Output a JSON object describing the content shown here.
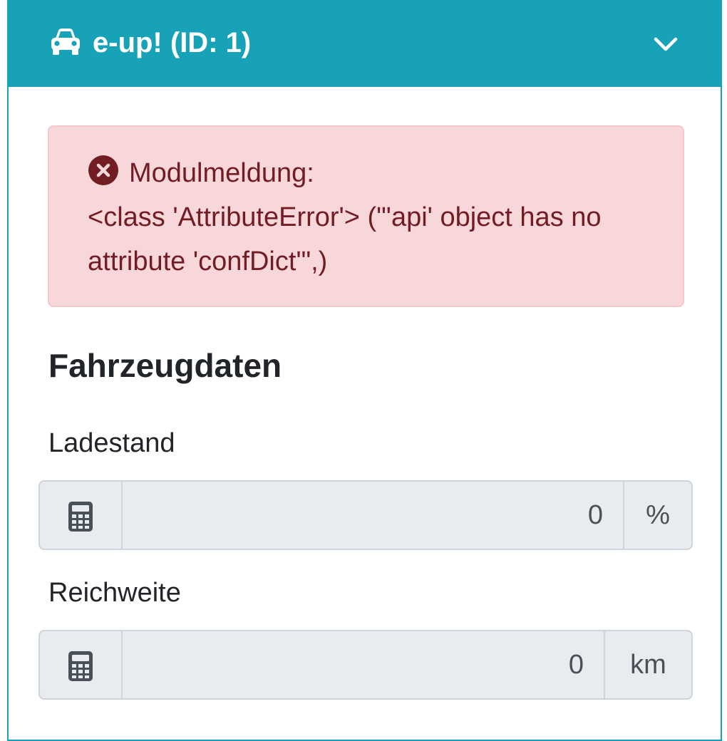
{
  "header": {
    "title": "e-up! (ID: 1)",
    "icon": "car-icon",
    "toggle_icon": "chevron-down-icon",
    "background_color": "#17a2b8"
  },
  "alert": {
    "icon": "error-circle-icon",
    "heading": "Modulmeldung:",
    "line1": "<class 'AttributeError'> (\"'api' object has no",
    "line2": "attribute 'confDict'\",)",
    "background_color": "#f8d7da",
    "text_color": "#721c24"
  },
  "section": {
    "title": "Fahrzeugdaten"
  },
  "fields": [
    {
      "label": "Ladestand",
      "value": "0",
      "unit": "%",
      "icon": "calculator-icon"
    },
    {
      "label": "Reichweite",
      "value": "0",
      "unit": "km",
      "icon": "calculator-icon"
    }
  ]
}
